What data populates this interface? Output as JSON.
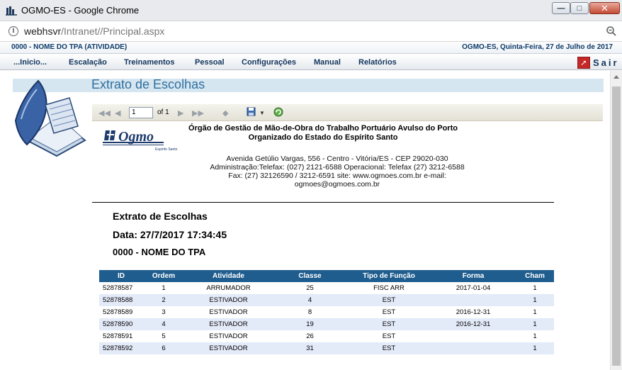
{
  "browser": {
    "title": "OGMO-ES - Google Chrome",
    "url_host": "webhsvr",
    "url_path": "/Intranet//Principal.aspx"
  },
  "header": {
    "user": "0000 - NOME DO TPA (ATIVIDADE)",
    "date": "OGMO-ES, Quinta-Feira, 27 de Julho de 2017"
  },
  "menu": {
    "items": [
      "...Inicio...",
      "Escalação",
      "Treinamentos",
      "Pessoal",
      "Configurações",
      "Manual",
      "Relatórios"
    ],
    "exit_label": "Sair"
  },
  "page": {
    "heading": "Extrato de Escolhas"
  },
  "viewer": {
    "page_current": "1",
    "page_of": "of 1"
  },
  "report": {
    "logo_text": "Ogmo",
    "logo_sub": "Espírito Santo",
    "org_line1": "Órgão de Gestão de Mão-de-Obra do Trabalho Portuário Avulso do Porto",
    "org_line2": "Organizado do Estado do Espírito Santo",
    "address_line1": "Avenida Getúlio Vargas, 556 - Centro - Vitória/ES - CEP 29020-030",
    "address_line2": "Administração:Telefax: (027) 2121-6588  Operacional: Telefax (27) 3212-6588",
    "address_line3": "Fax: (27) 32126590 / 3212-6591 site: www.ogmoes.com.br e-mail:",
    "address_line4": "ogmoes@ogmoes.com.br",
    "title": "Extrato de Escolhas",
    "date": "Data: 27/7/2017 17:34:45",
    "worker": "0000 - NOME DO TPA"
  },
  "table": {
    "columns": [
      "ID",
      "Ordem",
      "Atividade",
      "Classe",
      "Tipo de Função",
      "Forma",
      "Cham"
    ],
    "rows": [
      [
        "52878587",
        "1",
        "ARRUMADOR",
        "25",
        "FISC ARR",
        "2017-01-04",
        "1"
      ],
      [
        "52878588",
        "2",
        "ESTIVADOR",
        "4",
        "EST",
        "",
        "1"
      ],
      [
        "52878589",
        "3",
        "ESTIVADOR",
        "8",
        "EST",
        "2016-12-31",
        "1"
      ],
      [
        "52878590",
        "4",
        "ESTIVADOR",
        "19",
        "EST",
        "2016-12-31",
        "1"
      ],
      [
        "52878591",
        "5",
        "ESTIVADOR",
        "26",
        "EST",
        "",
        "1"
      ],
      [
        "52878592",
        "6",
        "ESTIVADOR",
        "31",
        "EST",
        "",
        "1"
      ]
    ]
  }
}
